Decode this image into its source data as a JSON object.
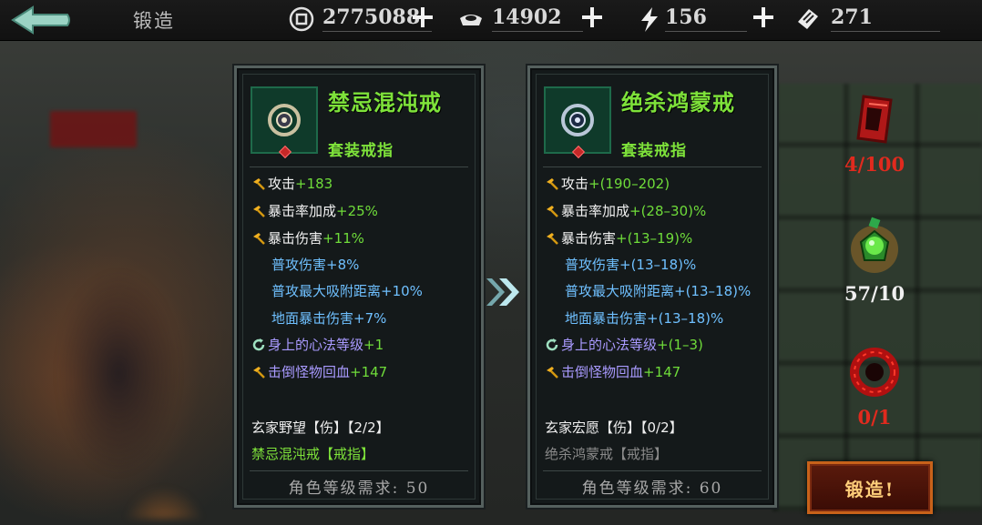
{
  "header": {
    "title": "锻造",
    "resources": [
      {
        "icon": "coin-icon",
        "value": "2775088"
      },
      {
        "icon": "silver-ingot-icon",
        "value": "14902"
      },
      {
        "icon": "lightning-icon",
        "value": "156"
      },
      {
        "icon": "ticket-icon",
        "value": "271"
      }
    ]
  },
  "current_item": {
    "name": "禁忌混沌戒",
    "type": "套装戒指",
    "stats": [
      {
        "label": "攻击",
        "value": "+183"
      },
      {
        "label": "暴击率加成",
        "value": "+25%"
      },
      {
        "label": "暴击伤害",
        "value": "+11%"
      },
      {
        "label": "普攻伤害",
        "value": "+8%"
      },
      {
        "label": "普攻最大吸附距离",
        "value": "+10%"
      },
      {
        "label": "地面暴击伤害",
        "value": "+7%"
      },
      {
        "label": "身上的心法等级",
        "value": "+1"
      },
      {
        "label": "击倒怪物回血",
        "value": "+147"
      }
    ],
    "set_name": "玄家野望【伤】【2/2】",
    "set_piece": "禁忌混沌戒【戒指】",
    "requirement": "角色等级需求: 50"
  },
  "target_item": {
    "name": "绝杀鸿蒙戒",
    "type": "套装戒指",
    "stats": [
      {
        "label": "攻击",
        "value": "+(190–202)"
      },
      {
        "label": "暴击率加成",
        "value": "+(28–30)%"
      },
      {
        "label": "暴击伤害",
        "value": "+(13–19)%"
      },
      {
        "label": "普攻伤害",
        "value": "+(13–18)%"
      },
      {
        "label": "普攻最大吸附距离",
        "value": "+(13–18)%"
      },
      {
        "label": "地面暴击伤害",
        "value": "+(13–18)%"
      },
      {
        "label": "身上的心法等级",
        "value": "+(1–3)"
      },
      {
        "label": "击倒怪物回血",
        "value": "+147"
      }
    ],
    "set_name": "玄家宏愿【伤】【0/2】",
    "set_piece": "绝杀鸿蒙戒【戒指】",
    "requirement": "角色等级需求: 60"
  },
  "materials": [
    {
      "icon": "red-crystal-icon",
      "count": "4/100",
      "color": "#e02a1e"
    },
    {
      "icon": "green-orb-icon",
      "count": "57/10",
      "color": "#f0f0f0"
    },
    {
      "icon": "red-ring-icon",
      "count": "0/1",
      "color": "#e02a1e"
    }
  ],
  "forge_button": "锻造!",
  "colors": {
    "item_name": "#7ee23a",
    "stat_value": "#6fdc3a",
    "secondary_stat": "#6fc0ff",
    "special_stat": "#a99aff"
  }
}
